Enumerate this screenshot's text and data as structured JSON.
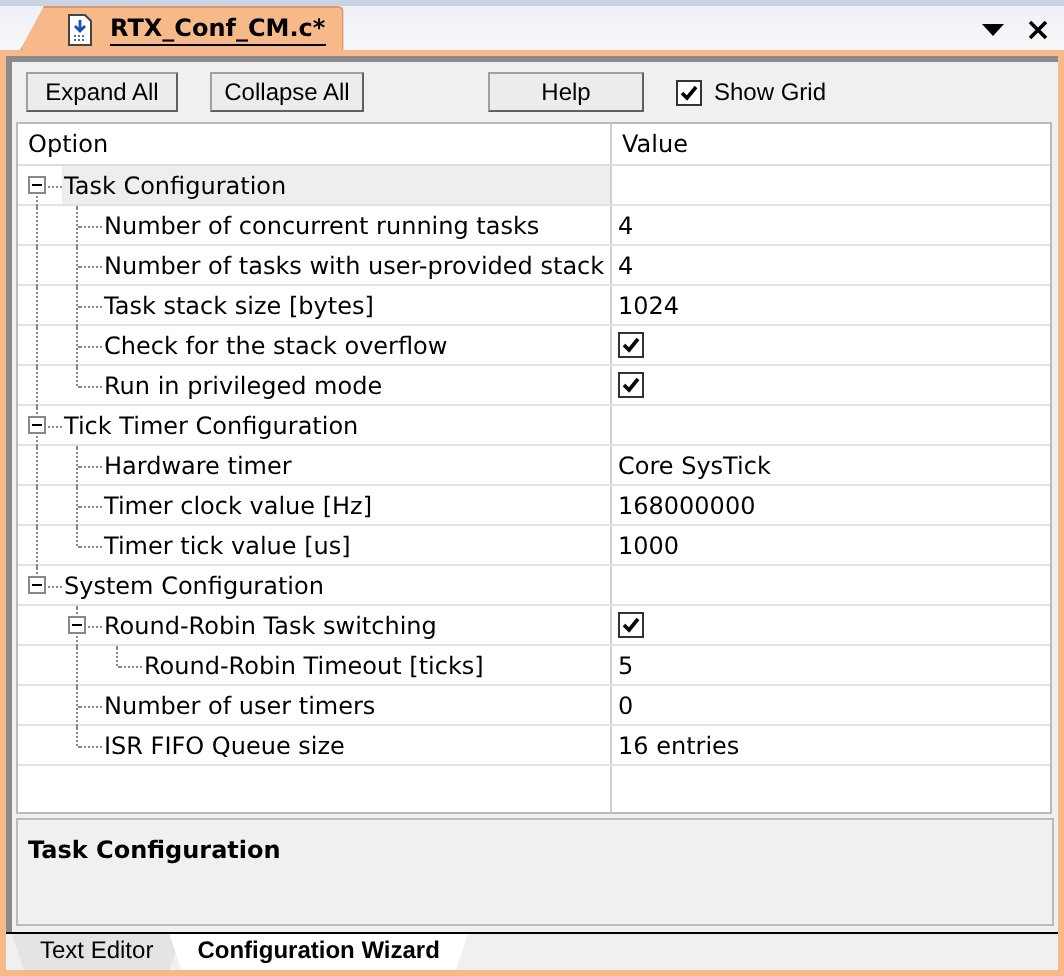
{
  "editor_tab": {
    "title": "RTX_Conf_CM.c*"
  },
  "toolbar": {
    "buttons": [
      "Expand All",
      "Collapse All",
      "Help"
    ],
    "show_grid": {
      "label": "Show Grid",
      "checked": true
    }
  },
  "grid": {
    "columns": [
      "Option",
      "Value"
    ],
    "rows": [
      {
        "option": "Task Configuration",
        "selected": true,
        "expanded": true,
        "children": [
          {
            "option": "Number of concurrent running tasks",
            "selected": false,
            "value": {
              "kind": "text",
              "text": "4"
            }
          },
          {
            "option": "Number of tasks with user-provided stack",
            "selected": false,
            "value": {
              "kind": "text",
              "text": "4"
            }
          },
          {
            "option": "Task stack size [bytes]",
            "selected": false,
            "value": {
              "kind": "text",
              "text": "1024"
            }
          },
          {
            "option": "Check for the stack overflow",
            "selected": false,
            "value": {
              "kind": "check",
              "checked": true
            }
          },
          {
            "option": "Run in privileged mode",
            "selected": false,
            "value": {
              "kind": "check",
              "checked": true
            }
          }
        ]
      },
      {
        "option": "Tick Timer Configuration",
        "selected": false,
        "expanded": true,
        "children": [
          {
            "option": "Hardware timer",
            "selected": false,
            "value": {
              "kind": "text",
              "text": "Core SysTick"
            }
          },
          {
            "option": "Timer clock value [Hz]",
            "selected": false,
            "value": {
              "kind": "text",
              "text": "168000000"
            }
          },
          {
            "option": "Timer tick value [us]",
            "selected": false,
            "value": {
              "kind": "text",
              "text": "1000"
            }
          }
        ]
      },
      {
        "option": "System Configuration",
        "selected": false,
        "expanded": true,
        "children": [
          {
            "option": "Round-Robin Task switching",
            "selected": false,
            "expanded": true,
            "value": {
              "kind": "check",
              "checked": true
            },
            "children": [
              {
                "option": "Round-Robin Timeout [ticks]",
                "selected": false,
                "value": {
                  "kind": "text",
                  "text": "5"
                }
              }
            ]
          },
          {
            "option": "Number of user timers",
            "selected": false,
            "value": {
              "kind": "text",
              "text": "0"
            }
          },
          {
            "option": "ISR FIFO Queue size",
            "selected": false,
            "value": {
              "kind": "text",
              "text": "16 entries"
            }
          }
        ]
      }
    ]
  },
  "description": "Task Configuration",
  "bottom_tabs": [
    {
      "label": "Text Editor",
      "selected": false
    },
    {
      "label": "Configuration Wizard",
      "selected": true
    }
  ]
}
